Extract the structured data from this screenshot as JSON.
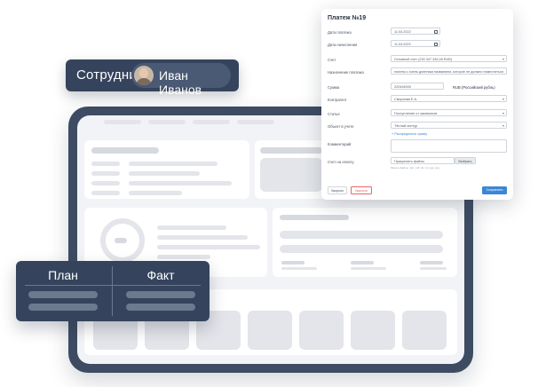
{
  "employee": {
    "label": "Сотрудник:",
    "name": "Иван Иванов"
  },
  "plan_fact": {
    "plan": "План",
    "fact": "Факт"
  },
  "payment": {
    "title": "Платеж №19",
    "fields": {
      "payment_date": {
        "label": "Дата платежа",
        "value": "11.04.2022"
      },
      "accrual_date": {
        "label": "Дата начисления",
        "value": "11.04.2022"
      },
      "account": {
        "label": "Счет",
        "value": "Основной счет (230 347 345,28 RUB)"
      },
      "purpose": {
        "label": "Назначение платежа",
        "value": "платеж с очень длинным названием, которое не должно поместиться"
      },
      "amount": {
        "label": "Сумма",
        "value": "220444000",
        "currency": "RUB (Российский рубль)"
      },
      "counterparty": {
        "label": "Контрагент",
        "value": "Смирнова Е.А."
      },
      "article": {
        "label": "Статья",
        "value": "Поступление от заказчиков"
      },
      "accounting_object": {
        "label": "Объект в учете",
        "value": "Тёплый контур"
      },
      "distribute_link": "+ Распределить сумму",
      "comment": {
        "label": "Комментарий",
        "value": ""
      },
      "invoice": {
        "label": "Счет на оплату",
        "attach": "Прикрепить файлы",
        "pick": "Выбрать",
        "hint": "Можно файлы .doc .pdf .xls .txt .jpg .png"
      }
    },
    "buttons": {
      "close": "Закрыть",
      "delete": "Удалить",
      "save": "Сохранить"
    }
  }
}
